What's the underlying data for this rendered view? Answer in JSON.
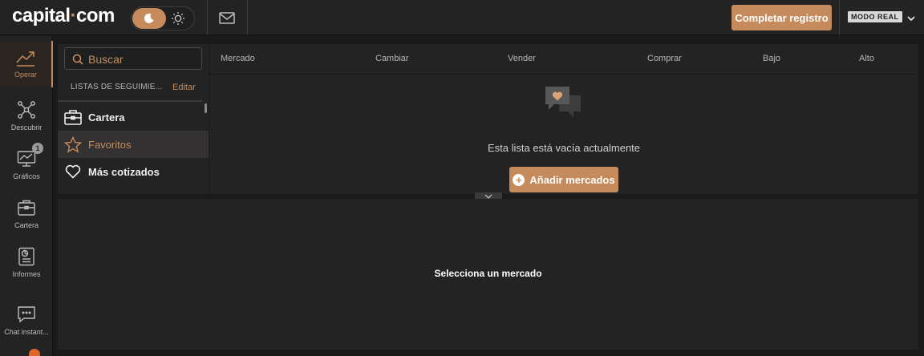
{
  "header": {
    "logo": {
      "left": "capital",
      "dot": "·",
      "right": "com"
    },
    "register_label": "Completar registro",
    "mode_label": "MODO REAL"
  },
  "nav": {
    "items": [
      {
        "label": "Operar",
        "icon": "chart-trend-icon",
        "active": true
      },
      {
        "label": "Descubrir",
        "icon": "network-icon"
      },
      {
        "label": "Gráficos",
        "icon": "monitor-chart-icon",
        "badge": "1"
      },
      {
        "label": "Cartera",
        "icon": "briefcase-icon"
      },
      {
        "label": "Informes",
        "icon": "report-icon"
      },
      {
        "label": "Chat instant...",
        "icon": "chat-icon"
      }
    ]
  },
  "watchlist": {
    "search_placeholder": "Buscar",
    "header": "LISTAS DE SEGUIMIE...",
    "edit_label": "Editar",
    "items": [
      {
        "label": "Cartera",
        "icon": "briefcase-icon"
      },
      {
        "label": "Favoritos",
        "icon": "star-icon",
        "selected": true
      },
      {
        "label": "Más cotizados",
        "icon": "heart-icon"
      }
    ]
  },
  "market_table": {
    "columns": [
      "Mercado",
      "Cambiar",
      "Vender",
      "Comprar",
      "Bajo",
      "Alto"
    ],
    "empty_text": "Esta lista está vacía actualmente",
    "add_label": "Añadir mercados"
  },
  "detail": {
    "empty_text": "Selecciona un mercado"
  },
  "colors": {
    "accent": "#c58b5c",
    "background": "#1a1a1a",
    "panel": "#232323"
  }
}
